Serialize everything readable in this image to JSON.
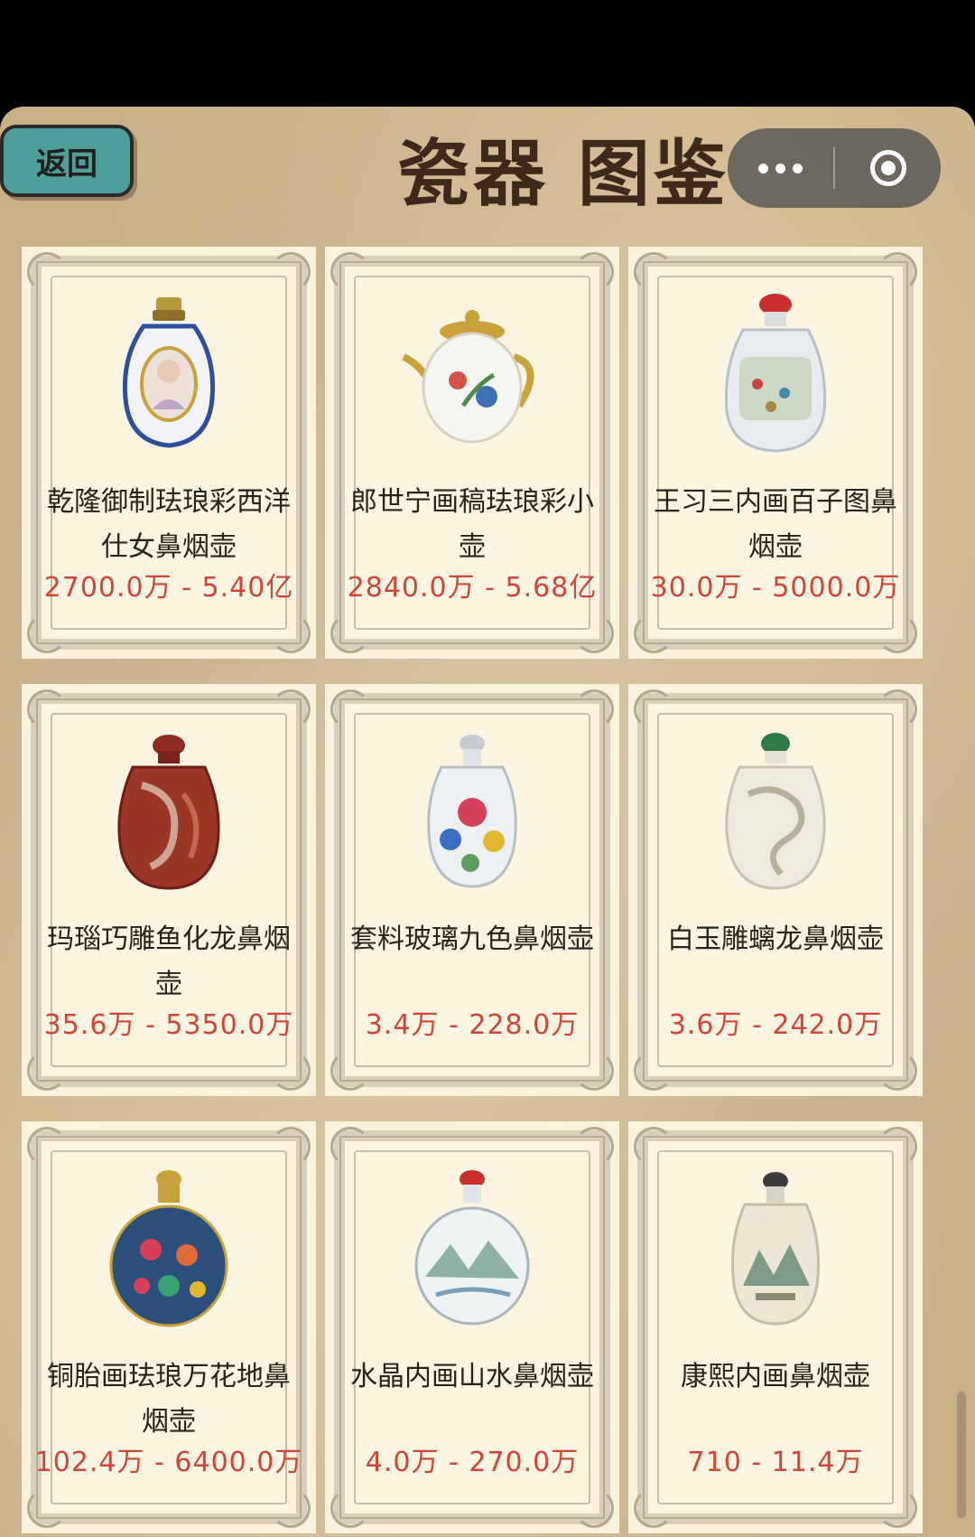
{
  "header": {
    "back_label": "返回",
    "title": "瓷器 图鉴"
  },
  "items": [
    {
      "name": "乾隆御制珐琅彩西洋仕女鼻烟壶",
      "price": "2700.0万 - 5.40亿"
    },
    {
      "name": "郎世宁画稿珐琅彩小壶",
      "price": "2840.0万 - 5.68亿"
    },
    {
      "name": "王习三内画百子图鼻烟壶",
      "price": "30.0万 - 5000.0万"
    },
    {
      "name": "玛瑙巧雕鱼化龙鼻烟壶",
      "price": "35.6万 - 5350.0万"
    },
    {
      "name": "套料玻璃九色鼻烟壶",
      "price": "3.4万 - 228.0万"
    },
    {
      "name": "白玉雕螭龙鼻烟壶",
      "price": "3.6万 - 242.0万"
    },
    {
      "name": "铜胎画珐琅万花地鼻烟壶",
      "price": "102.4万 - 6400.0万"
    },
    {
      "name": "水晶内画山水鼻烟壶",
      "price": "4.0万 - 270.0万"
    },
    {
      "name": "康熙内画鼻烟壶",
      "price": "710 - 11.4万"
    }
  ],
  "icons": {
    "more": "more-dots-icon",
    "close": "target-circle-icon"
  },
  "colors": {
    "price": "#cf4536",
    "back_button": "#4e9f9a"
  }
}
